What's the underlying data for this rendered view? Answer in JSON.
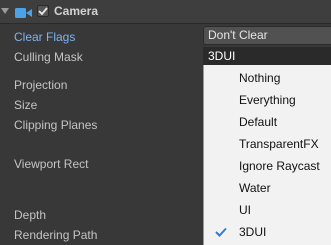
{
  "component": {
    "title": "Camera",
    "enabled": true
  },
  "properties": [
    "Clear Flags",
    "Culling Mask",
    "Projection",
    "Size",
    "Clipping Planes",
    "Viewport Rect",
    "Depth",
    "Rendering Path"
  ],
  "clear_flags": {
    "value": "Don't Clear"
  },
  "culling_mask": {
    "value": "3DUI",
    "options": [
      "Nothing",
      "Everything",
      "Default",
      "TransparentFX",
      "Ignore Raycast",
      "Water",
      "UI",
      "3DUI"
    ],
    "checked": "3DUI"
  },
  "colors": {
    "accent": "#7db4f0",
    "checkmark": "#2f7fd8",
    "camera_icon": "#4aa3e8"
  }
}
